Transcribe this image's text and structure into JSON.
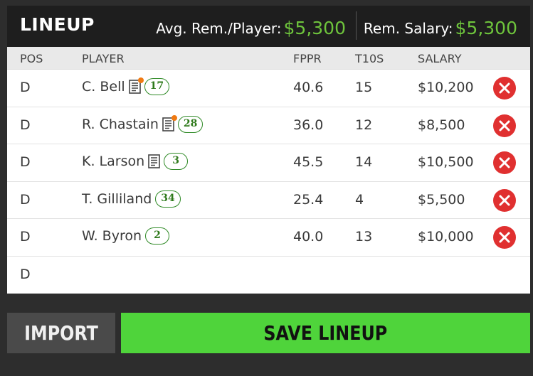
{
  "header": {
    "title": "LINEUP",
    "avg_label": "Avg. Rem./Player:",
    "avg_value": "$5,300",
    "rem_label": "Rem. Salary:",
    "rem_value": "$5,300"
  },
  "columns": {
    "pos": "POS",
    "player": "PLAYER",
    "fppr": "FPPR",
    "t10s": "T10S",
    "salary": "SALARY"
  },
  "rows": [
    {
      "pos": "D",
      "player": "C. Bell",
      "note": true,
      "note_alert": true,
      "number": "17",
      "fppr": "40.6",
      "t10s": "15",
      "salary": "$10,200",
      "removable": true
    },
    {
      "pos": "D",
      "player": "R. Chastain",
      "note": true,
      "note_alert": true,
      "number": "28",
      "fppr": "36.0",
      "t10s": "12",
      "salary": "$8,500",
      "removable": true
    },
    {
      "pos": "D",
      "player": "K. Larson",
      "note": true,
      "note_alert": false,
      "number": "3",
      "fppr": "45.5",
      "t10s": "14",
      "salary": "$10,500",
      "removable": true
    },
    {
      "pos": "D",
      "player": "T. Gilliland",
      "note": false,
      "note_alert": false,
      "number": "34",
      "fppr": "25.4",
      "t10s": "4",
      "salary": "$5,500",
      "removable": true
    },
    {
      "pos": "D",
      "player": "W. Byron",
      "note": false,
      "note_alert": false,
      "number": "2",
      "fppr": "40.0",
      "t10s": "13",
      "salary": "$10,000",
      "removable": true
    },
    {
      "pos": "D",
      "player": "",
      "note": false,
      "note_alert": false,
      "number": "",
      "fppr": "",
      "t10s": "",
      "salary": "",
      "removable": false
    }
  ],
  "buttons": {
    "import": "IMPORT",
    "save": "SAVE LINEUP"
  },
  "colors": {
    "accent_green": "#6ec43c",
    "save_green": "#4fd43b",
    "remove_red": "#e03030",
    "alert_orange": "#f07a12"
  }
}
